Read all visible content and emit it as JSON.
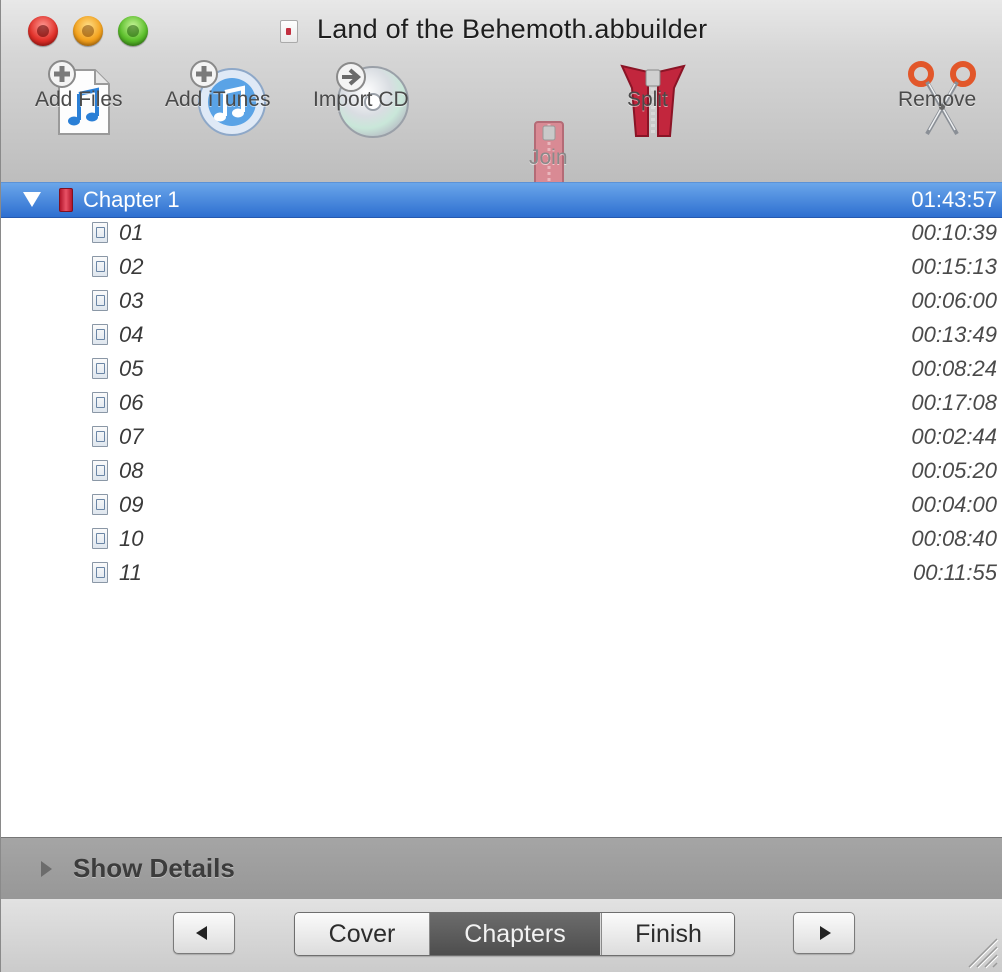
{
  "window": {
    "title": "Land of the Behemoth.abbuilder"
  },
  "toolbar": {
    "add_files": "Add Files",
    "add_itunes": "Add iTunes",
    "import_cd": "Import CD",
    "join": "Join",
    "split": "Split",
    "remove": "Remove"
  },
  "chapter": {
    "label": "Chapter 1",
    "duration": "01:43:57"
  },
  "tracks": [
    {
      "label": "01",
      "duration": "00:10:39"
    },
    {
      "label": "02",
      "duration": "00:15:13"
    },
    {
      "label": "03",
      "duration": "00:06:00"
    },
    {
      "label": "04",
      "duration": "00:13:49"
    },
    {
      "label": "05",
      "duration": "00:08:24"
    },
    {
      "label": "06",
      "duration": "00:17:08"
    },
    {
      "label": "07",
      "duration": "00:02:44"
    },
    {
      "label": "08",
      "duration": "00:05:20"
    },
    {
      "label": "09",
      "duration": "00:04:00"
    },
    {
      "label": "10",
      "duration": "00:08:40"
    },
    {
      "label": "11",
      "duration": "00:11:55"
    }
  ],
  "details": {
    "label": "Show Details"
  },
  "steps": {
    "cover": "Cover",
    "chapters": "Chapters",
    "finish": "Finish",
    "selected": "Chapters"
  },
  "icons": {
    "close": "close-icon",
    "minimize": "minimize-icon",
    "zoom": "zoom-icon",
    "document": "document-icon",
    "add_files": "add-files-icon",
    "add_itunes": "add-itunes-icon",
    "import_cd": "import-cd-icon",
    "join": "join-zipper-icon",
    "split": "split-zipper-icon",
    "remove": "scissors-icon",
    "disclosure": "disclosure-triangle-icon",
    "chapter": "book-icon",
    "track": "audio-file-icon",
    "prev": "previous-arrow-icon",
    "next": "next-arrow-icon",
    "grip": "resize-grip-icon"
  },
  "colors": {
    "selection": "#2e6fd0",
    "zipper": "#c2263d",
    "selected_segment": "#5a5a5a"
  }
}
